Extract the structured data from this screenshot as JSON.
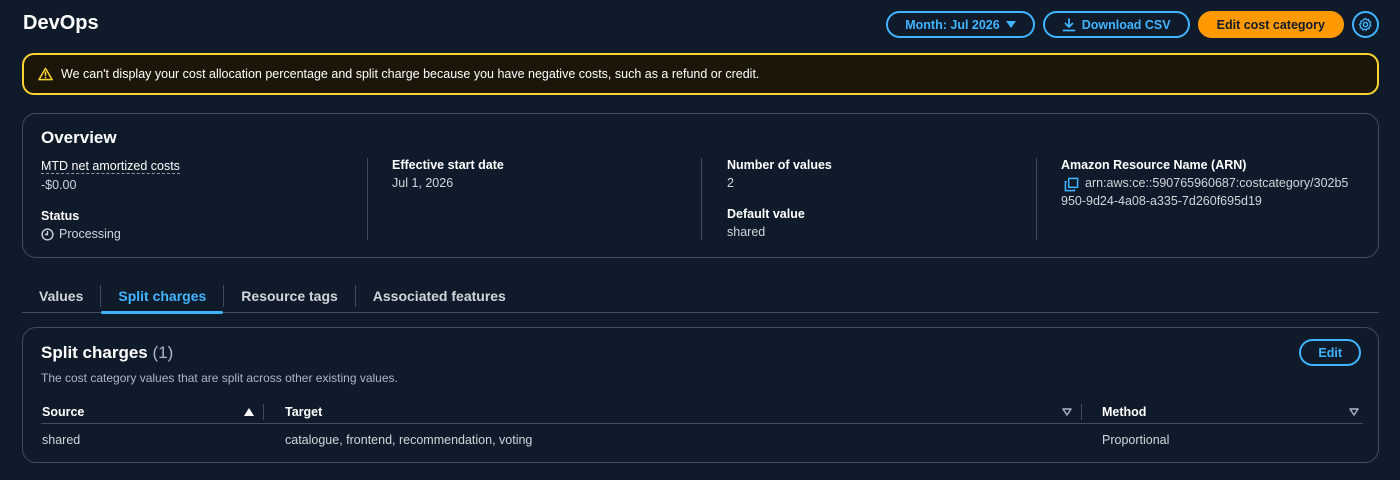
{
  "header": {
    "title": "DevOps",
    "month_label": "Month: Jul 2026",
    "download_label": "Download CSV",
    "edit_label": "Edit cost category"
  },
  "alert": {
    "message": "We can't display your cost allocation percentage and split charge because you have negative costs, such as a refund or credit."
  },
  "overview": {
    "title": "Overview",
    "mtd_label": "MTD net amortized costs",
    "mtd_value": "-$0.00",
    "status_label": "Status",
    "status_value": "Processing",
    "start_label": "Effective start date",
    "start_value": "Jul 1, 2026",
    "num_values_label": "Number of values",
    "num_values_value": "2",
    "default_label": "Default value",
    "default_value": "shared",
    "arn_label": "Amazon Resource Name (ARN)",
    "arn_line1": "arn:aws:ce::590765960687:costcategory/302b5",
    "arn_line2": "950-9d24-4a08-a335-7d260f695d19"
  },
  "tabs": [
    {
      "label": "Values"
    },
    {
      "label": "Split charges"
    },
    {
      "label": "Resource tags"
    },
    {
      "label": "Associated features"
    }
  ],
  "split_charges": {
    "title": "Split charges",
    "count": "(1)",
    "description": "The cost category values that are split across other existing values.",
    "edit_label": "Edit",
    "columns": [
      "Source",
      "Target",
      "Method"
    ],
    "rows": [
      {
        "source": "shared",
        "target": "catalogue, frontend, recommendation, voting",
        "method": "Proportional"
      }
    ]
  },
  "colors": {
    "accent": "#42b4ff",
    "primary": "#ff9900",
    "warning": "#fbd332"
  },
  "icons": [
    "caret-down-icon",
    "download-icon",
    "settings-icon",
    "warning-icon",
    "clock-icon",
    "copy-icon",
    "sort-ascending-icon",
    "sort-icon"
  ]
}
